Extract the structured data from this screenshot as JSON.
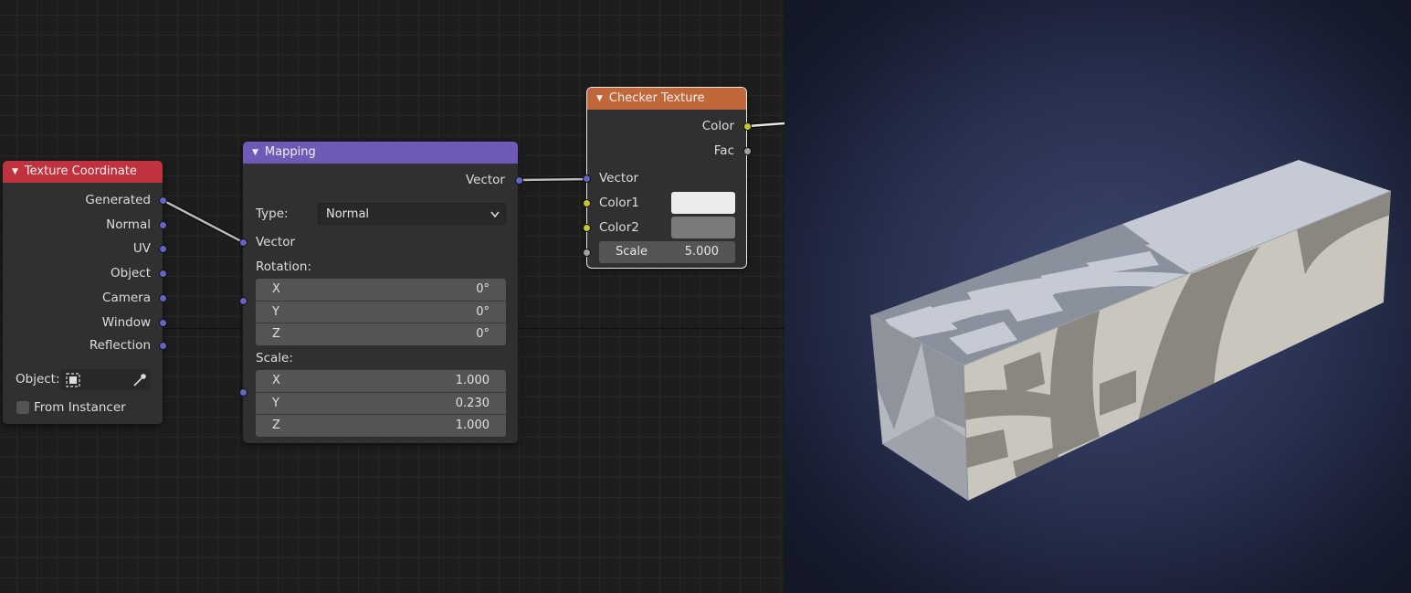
{
  "texture_coordinate": {
    "title": "Texture Coordinate",
    "outputs": [
      "Generated",
      "Normal",
      "UV",
      "Object",
      "Camera",
      "Window",
      "Reflection"
    ],
    "object_label": "Object:",
    "from_instancer_label": "From Instancer",
    "header_color": "#c0323d"
  },
  "mapping": {
    "title": "Mapping",
    "output_vector": "Vector",
    "type_label": "Type:",
    "type_value": "Normal",
    "input_vector": "Vector",
    "rotation_label": "Rotation:",
    "rotation": [
      {
        "axis": "X",
        "value": "0°"
      },
      {
        "axis": "Y",
        "value": "0°"
      },
      {
        "axis": "Z",
        "value": "0°"
      }
    ],
    "scale_label": "Scale:",
    "scale": [
      {
        "axis": "X",
        "value": "1.000"
      },
      {
        "axis": "Y",
        "value": "0.230"
      },
      {
        "axis": "Z",
        "value": "1.000"
      }
    ],
    "header_color": "#6f5ab5"
  },
  "checker": {
    "title": "Checker Texture",
    "output_color": "Color",
    "output_fac": "Fac",
    "input_vector": "Vector",
    "color1_label": "Color1",
    "color2_label": "Color2",
    "scale_label": "Scale",
    "scale_value": "5.000",
    "color1": "#ececec",
    "color2": "#7a7a7a",
    "header_color": "#c0683a"
  },
  "colors": {
    "vector_socket": "#6464c8",
    "color_socket": "#c7c729",
    "float_socket": "#a1a1a1"
  }
}
